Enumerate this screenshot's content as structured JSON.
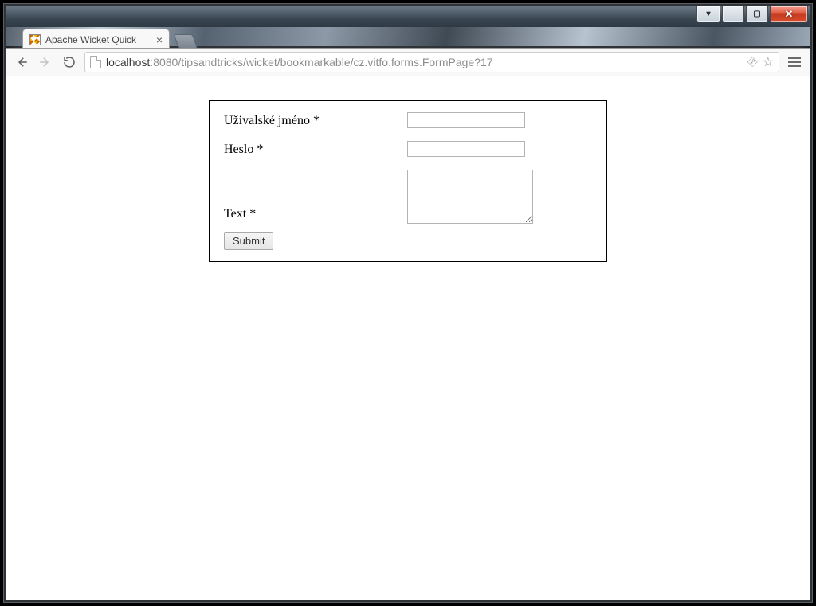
{
  "browser": {
    "tab_title": "Apache Wicket Quick",
    "url_host": "localhost",
    "url_port_path": ":8080/tipsandtricks/wicket/bookmarkable/cz.vitfo.forms.FormPage?17"
  },
  "caption": {
    "gadget1": "▾",
    "min": "—",
    "max": "▢",
    "close": "✕"
  },
  "form": {
    "username_label": "Uživalské jméno *",
    "password_label": "Heslo *",
    "text_label": "Text *",
    "username_value": "",
    "password_value": "",
    "text_value": "",
    "submit_label": "Submit"
  }
}
